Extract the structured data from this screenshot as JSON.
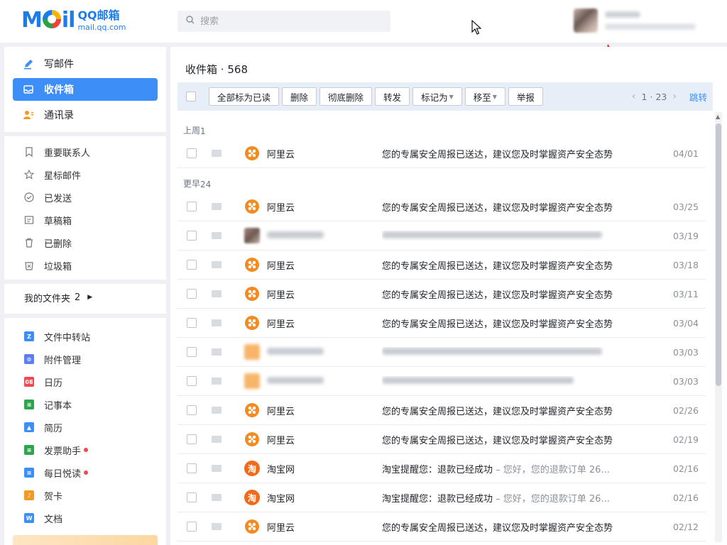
{
  "logo": {
    "text": "QQ邮箱",
    "domain": "mail.qq.com",
    "moil_letters": [
      "M",
      "il"
    ]
  },
  "search": {
    "placeholder": "搜索"
  },
  "nav_top": [
    {
      "label": "写邮件",
      "icon": "pen-icon"
    },
    {
      "label": "收件箱",
      "icon": "inbox-icon",
      "active": true
    },
    {
      "label": "通讯录",
      "icon": "contacts-icon"
    }
  ],
  "nav_folders": [
    {
      "label": "重要联系人",
      "icon": "bookmark-icon"
    },
    {
      "label": "星标邮件",
      "icon": "star-icon"
    },
    {
      "label": "已发送",
      "icon": "check-circle-icon"
    },
    {
      "label": "草稿箱",
      "icon": "draft-icon"
    },
    {
      "label": "已删除",
      "icon": "trash-icon"
    },
    {
      "label": "垃圾箱",
      "icon": "spam-icon"
    }
  ],
  "my_folders": {
    "label": "我的文件夹",
    "count": "2"
  },
  "tools": [
    {
      "label": "文件中转站",
      "color": "#3e8ef7",
      "glyph": "Z",
      "badge": false
    },
    {
      "label": "附件管理",
      "color": "#5b7ef2",
      "glyph": "⊙",
      "badge": false
    },
    {
      "label": "日历",
      "color": "#f0494f",
      "glyph": "08",
      "badge": false
    },
    {
      "label": "记事本",
      "color": "#2ea44f",
      "glyph": "≡",
      "badge": false
    },
    {
      "label": "简历",
      "color": "#3e8ef7",
      "glyph": "▲",
      "badge": false
    },
    {
      "label": "发票助手",
      "color": "#2ea44f",
      "glyph": "≡",
      "badge": true
    },
    {
      "label": "每日悦读",
      "color": "#3e8ef7",
      "glyph": "≡",
      "badge": true
    },
    {
      "label": "贺卡",
      "color": "#f29a26",
      "glyph": "♪",
      "badge": false
    },
    {
      "label": "文档",
      "color": "#3e8ef7",
      "glyph": "W",
      "badge": false
    }
  ],
  "inbox": {
    "title": "收件箱",
    "separator": "·",
    "count": "568"
  },
  "toolbar": {
    "buttons": [
      {
        "label": "全部标为已读",
        "name": "mark-all-read-button",
        "caret": false
      },
      {
        "label": "删除",
        "name": "delete-button",
        "caret": false
      },
      {
        "label": "彻底删除",
        "name": "delete-permanently-button",
        "caret": false
      },
      {
        "label": "转发",
        "name": "forward-button",
        "caret": false
      },
      {
        "label": "标记为",
        "name": "mark-as-button",
        "caret": true
      },
      {
        "label": "移至",
        "name": "move-to-button",
        "caret": true
      },
      {
        "label": "举报",
        "name": "report-button",
        "caret": false
      }
    ],
    "page": "1",
    "page_sep": "·",
    "pages": "23",
    "jump": "跳转"
  },
  "groups": [
    {
      "label": "上周",
      "count": "1",
      "emails": [
        {
          "avatar": "aliyun",
          "sender": "阿里云",
          "subject": "您的专属安全周报已送达，建议您及时掌握资产安全态势",
          "preview": "",
          "date": "04/01"
        }
      ]
    },
    {
      "label": "更早",
      "count": "24",
      "emails": [
        {
          "avatar": "aliyun",
          "sender": "阿里云",
          "subject": "您的专属安全周报已送达，建议您及时掌握资产安全态势",
          "preview": "",
          "date": "03/25"
        },
        {
          "avatar": "blurred",
          "sender": "",
          "subject": "",
          "preview": "",
          "date": "03/19"
        },
        {
          "avatar": "aliyun",
          "sender": "阿里云",
          "subject": "您的专属安全周报已送达，建议您及时掌握资产安全态势",
          "preview": "",
          "date": "03/18"
        },
        {
          "avatar": "aliyun",
          "sender": "阿里云",
          "subject": "您的专属安全周报已送达，建议您及时掌握资产安全态势",
          "preview": "",
          "date": "03/11"
        },
        {
          "avatar": "aliyun",
          "sender": "阿里云",
          "subject": "您的专属安全周报已送达，建议您及时掌握资产安全态势",
          "preview": "",
          "date": "03/04"
        },
        {
          "avatar": "blurred2",
          "sender": "",
          "subject": "",
          "preview": "",
          "date": "03/03"
        },
        {
          "avatar": "blurred2",
          "sender": "",
          "subject": "",
          "preview": "",
          "date": "03/03"
        },
        {
          "avatar": "aliyun",
          "sender": "阿里云",
          "subject": "您的专属安全周报已送达，建议您及时掌握资产安全态势",
          "preview": "",
          "date": "02/26"
        },
        {
          "avatar": "aliyun",
          "sender": "阿里云",
          "subject": "您的专属安全周报已送达，建议您及时掌握资产安全态势",
          "preview": "",
          "date": "02/19"
        },
        {
          "avatar": "taobao",
          "sender": "淘宝网",
          "subject": "淘宝提醒您：退款已经成功",
          "preview": " – 您好，您的退款订单 26...",
          "date": "02/16"
        },
        {
          "avatar": "taobao",
          "sender": "淘宝网",
          "subject": "淘宝提醒您：退款已经成功",
          "preview": " – 您好，您的退款订单 26...",
          "date": "02/16"
        },
        {
          "avatar": "aliyun",
          "sender": "阿里云",
          "subject": "您的专属安全周报已送达，建议您及时掌握资产安全态势",
          "preview": "",
          "date": "02/12"
        }
      ]
    }
  ],
  "colors": {
    "accent": "#3e8ef7",
    "toolbar_bg": "#e8eef8",
    "aliyun": "#f18b22",
    "taobao": "#f36a1c",
    "badge": "#f0494f"
  }
}
